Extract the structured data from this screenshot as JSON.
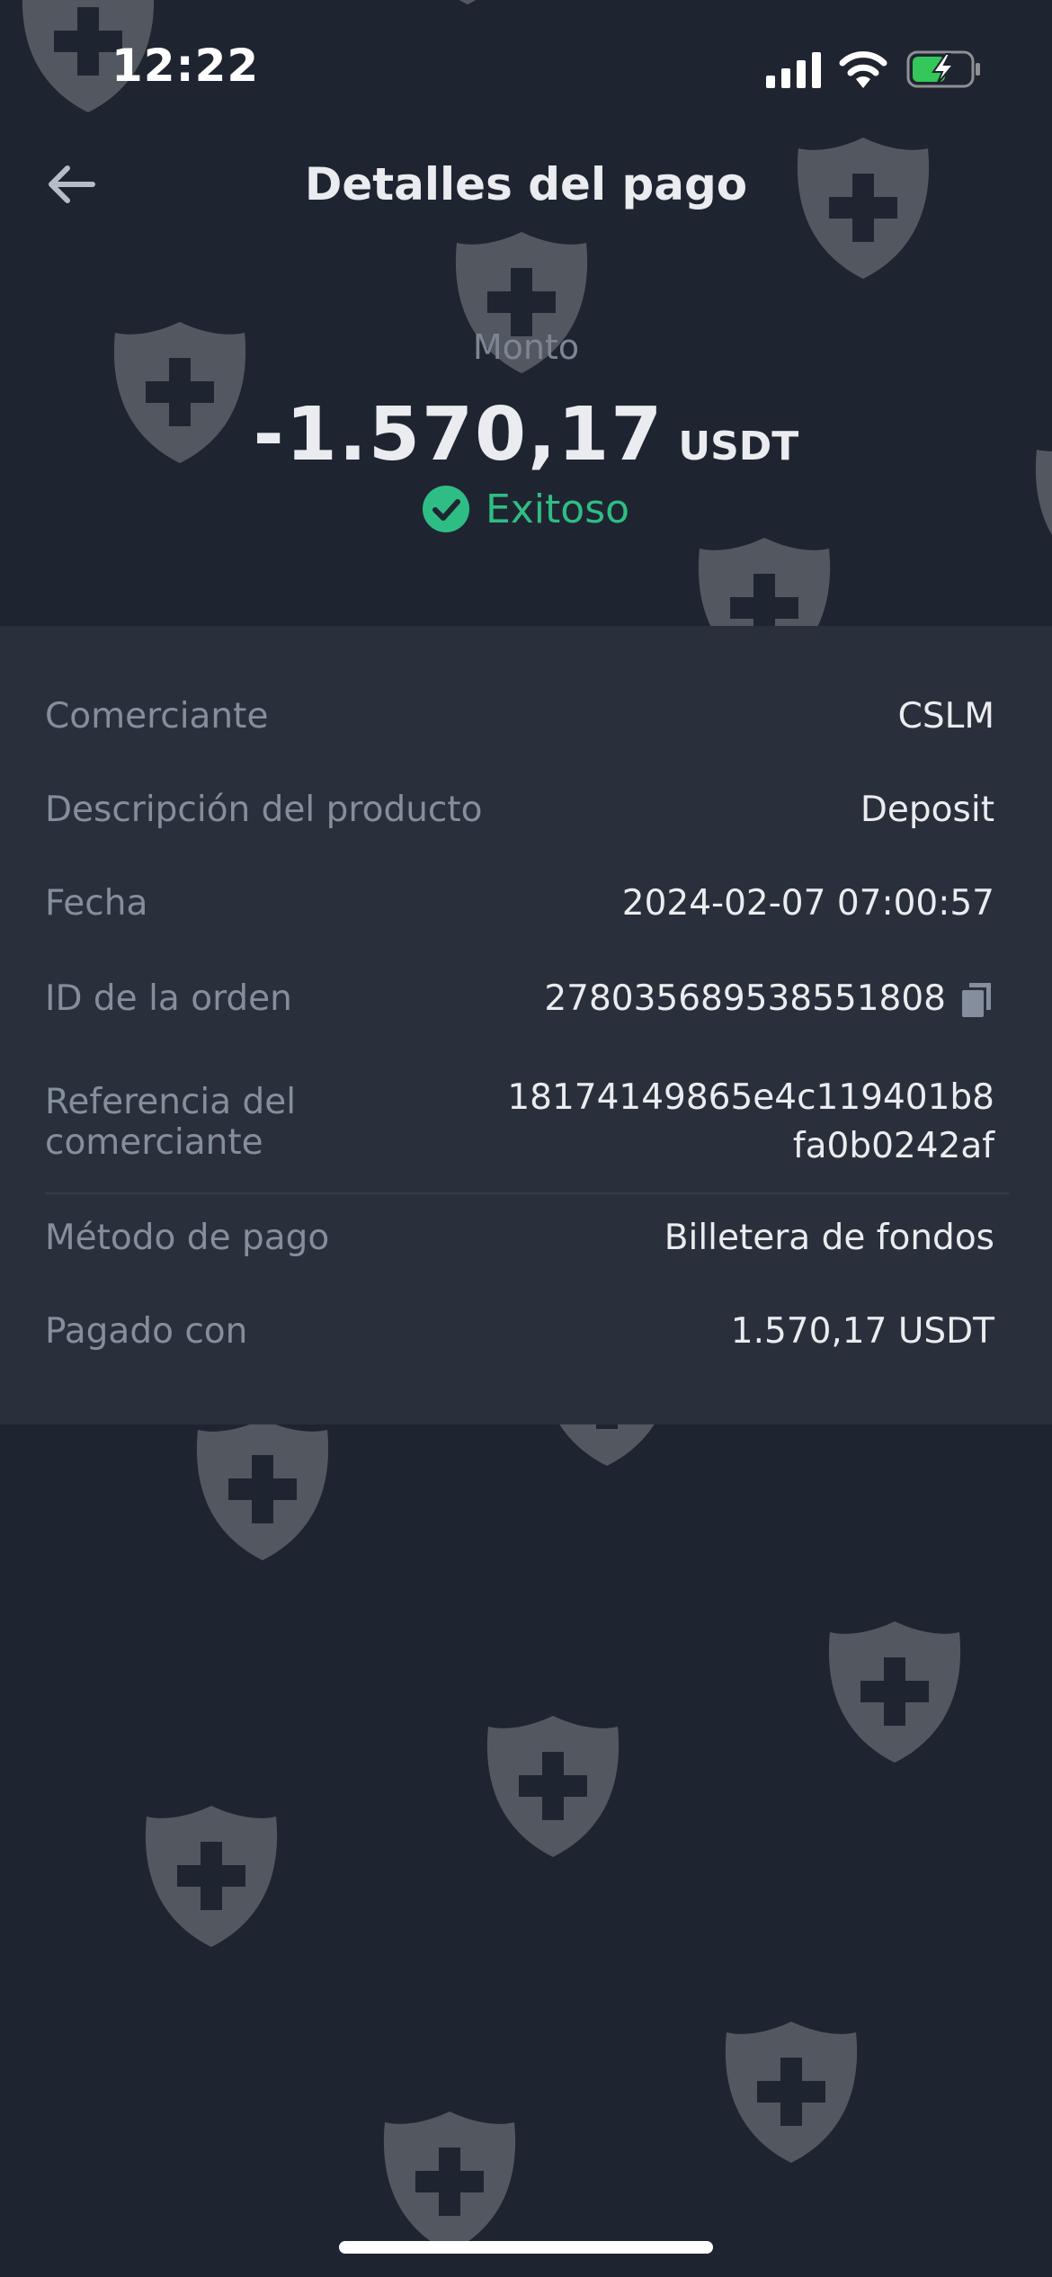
{
  "status_bar": {
    "time": "12:22",
    "signal_icon": "cellular-signal-icon",
    "wifi_icon": "wifi-icon",
    "battery_icon": "battery-charging-icon",
    "battery_color": "#34c759"
  },
  "header": {
    "back_icon": "arrow-left-icon",
    "title": "Detalles del pago"
  },
  "amount": {
    "label": "Monto",
    "value": "-1.570,17",
    "currency": "USDT"
  },
  "status": {
    "icon": "check-circle-icon",
    "text": "Exitoso",
    "color": "#2ebd85"
  },
  "details": {
    "merchant": {
      "label": "Comerciante",
      "value": "CSLM"
    },
    "product_description": {
      "label": "Descripción del producto",
      "value": "Deposit"
    },
    "date": {
      "label": "Fecha",
      "value": "2024-02-07 07:00:57"
    },
    "order_id": {
      "label": "ID de la orden",
      "value": "278035689538551808",
      "icon": "copy-icon"
    },
    "merchant_reference": {
      "label": "Referencia del comerciante",
      "value_line1": "18174149865e4c119401b8",
      "value_line2": "fa0b0242af"
    },
    "payment_method": {
      "label": "Método de pago",
      "value": "Billetera de fondos"
    },
    "paid_with": {
      "label": "Pagado con",
      "value": "1.570,17 USDT"
    }
  },
  "watermark_icon": "shield-plus-icon"
}
